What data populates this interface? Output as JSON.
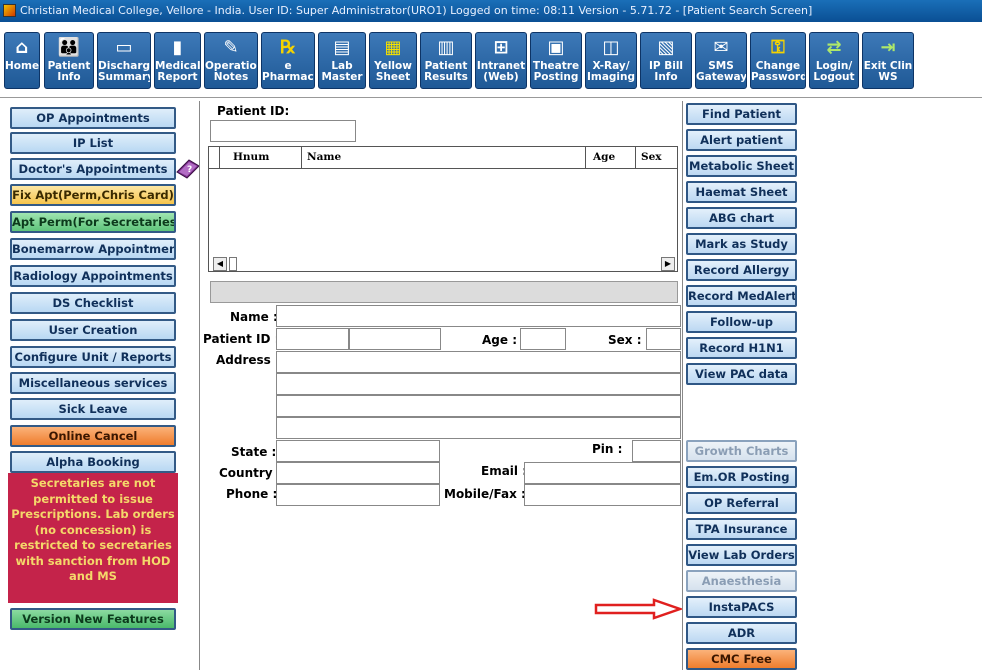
{
  "window": {
    "title": "Christian Medical College, Vellore - India.    User ID: Super Administrator(URO1)    Logged on time: 08:11    Version - 5.71.72 - [Patient Search Screen]"
  },
  "toolbar": {
    "items": [
      {
        "label": "Home",
        "icon": "home-icon"
      },
      {
        "label": "Patient\nInfo",
        "icon": "people-icon"
      },
      {
        "label": "Discharge\nSummary",
        "icon": "bed-icon"
      },
      {
        "label": "Medical\nReport",
        "icon": "chart-icon"
      },
      {
        "label": "Operation\nNotes",
        "icon": "pen-icon"
      },
      {
        "label": "e\nPharmacy",
        "icon": "rx-icon"
      },
      {
        "label": "Lab\nMaster",
        "icon": "clipboard-icon"
      },
      {
        "label": "Yellow\nSheet",
        "icon": "sheet-icon"
      },
      {
        "label": "Patient\nResults",
        "icon": "results-icon"
      },
      {
        "label": "Intranet\n(Web)",
        "icon": "network-icon"
      },
      {
        "label": "Theatre\nPosting",
        "icon": "theatre-icon"
      },
      {
        "label": "X-Ray/\nImaging",
        "icon": "xray-icon"
      },
      {
        "label": "IP Bill\nInfo",
        "icon": "bill-icon"
      },
      {
        "label": "SMS\nGateway",
        "icon": "sms-icon"
      },
      {
        "label": "Change\nPassword",
        "icon": "key-icon"
      },
      {
        "label": "Login/\nLogout",
        "icon": "login-icon"
      },
      {
        "label": "Exit Clin\nWS",
        "icon": "exit-icon"
      }
    ]
  },
  "left_menu": {
    "items": [
      {
        "label": "OP Appointments"
      },
      {
        "label": "IP List"
      },
      {
        "label": "Doctor's Appointments"
      },
      {
        "label": "Fix Apt(Perm,Chris Card)"
      },
      {
        "label": "Apt Perm(For Secretaries)"
      },
      {
        "label": "Bonemarrow Appointment"
      },
      {
        "label": "Radiology Appointments"
      },
      {
        "label": "DS Checklist"
      },
      {
        "label": "User Creation"
      },
      {
        "label": "Configure Unit / Reports"
      },
      {
        "label": "Miscellaneous services"
      },
      {
        "label": "Sick Leave"
      },
      {
        "label": "Online Cancel"
      },
      {
        "label": "Alpha Booking"
      }
    ],
    "notice": "Secretaries are not permitted to issue Prescriptions. Lab orders (no concession) is restricted to secretaries with sanction from HOD and MS",
    "version_button": "Version New Features"
  },
  "search": {
    "patient_id_label": "Patient ID:",
    "patient_id_value": "",
    "grid_columns": [
      "Hnum",
      "Name",
      "Age",
      "Sex"
    ]
  },
  "details": {
    "name_label": "Name :",
    "patient_id_label": "Patient ID :",
    "age_label": "Age :",
    "sex_label": "Sex :",
    "address_label": "Address :",
    "state_label": "State :",
    "pin_label": "Pin :",
    "country_label": "Country :",
    "email_label": "Email :",
    "phone_label": "Phone :",
    "mobile_label": "Mobile/Fax :"
  },
  "right_menu": {
    "items": [
      {
        "label": "Find Patient",
        "state": "enabled"
      },
      {
        "label": "Alert  patient",
        "state": "enabled"
      },
      {
        "label": "Metabolic Sheet",
        "state": "enabled"
      },
      {
        "label": "Haemat Sheet",
        "state": "enabled"
      },
      {
        "label": "ABG chart",
        "state": "enabled"
      },
      {
        "label": "Mark as Study",
        "state": "enabled"
      },
      {
        "label": "Record Allergy",
        "state": "enabled"
      },
      {
        "label": "Record MedAlert",
        "state": "enabled"
      },
      {
        "label": "Follow-up",
        "state": "enabled"
      },
      {
        "label": "Record H1N1",
        "state": "enabled"
      },
      {
        "label": "View PAC data",
        "state": "enabled"
      },
      {
        "label": "Growth Charts",
        "state": "disabled"
      },
      {
        "label": "Em.OR Posting",
        "state": "enabled"
      },
      {
        "label": "OP Referral",
        "state": "enabled"
      },
      {
        "label": "TPA Insurance",
        "state": "enabled"
      },
      {
        "label": "View Lab Orders",
        "state": "enabled"
      },
      {
        "label": "Anaesthesia",
        "state": "disabled"
      },
      {
        "label": "InstaPACS",
        "state": "enabled"
      },
      {
        "label": "ADR",
        "state": "enabled"
      },
      {
        "label": "CMC Free",
        "state": "highlight"
      }
    ]
  },
  "colors": {
    "titlebar": "#1a6fb8",
    "toolbar_button": "#2a66a6",
    "notice_bg": "#c4234a",
    "notice_text": "#f4d86a",
    "annotation_arrow": "#e0201f"
  }
}
